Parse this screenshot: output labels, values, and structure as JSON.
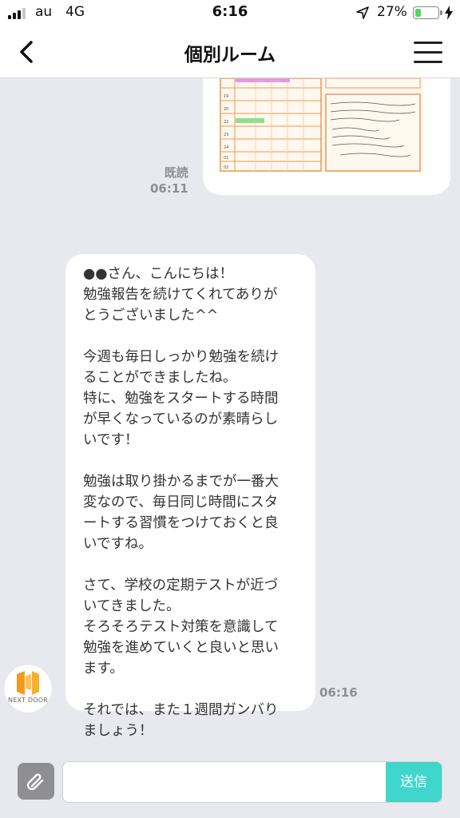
{
  "status_bar": {
    "carrier": "au",
    "network": "4G",
    "time": "6:16",
    "battery_percent": "27%",
    "battery_level": 0.27
  },
  "header": {
    "title": "個別ルーム"
  },
  "sent_message": {
    "read_label": "既読",
    "time": "06:11"
  },
  "received_message": {
    "lines": [
      "●●さん、こんにちは！",
      "勉強報告を続けてくれてありが",
      "とうございました^^",
      "",
      "今週も毎日しっかり勉強を続け",
      "ることができましたね。",
      "特に、勉強をスタートする時間",
      "が早くなっているのが素晴らし",
      "いです！",
      "",
      "勉強は取り掛かるまでが一番大",
      "変なので、毎日同じ時間にスタ",
      "ートする習慣をつけておくと良",
      "いですね。",
      "",
      "さて、学校の定期テストが近づ",
      "いてきました。",
      "そろそろテスト対策を意識して",
      "勉強を進めていくと良いと思い",
      "ます。",
      "",
      "それでは、また１週間ガンバり",
      "ましょう！"
    ],
    "time": "06:16",
    "sender_brand": "NEXT DOOR"
  },
  "composer": {
    "input_value": "",
    "send_label": "送信"
  },
  "colors": {
    "background": "#e8e8ef",
    "send_button": "#3fd6cc",
    "battery_fill": "#4cd964"
  },
  "icons": {
    "back": "chevron-left-icon",
    "menu": "hamburger-menu-icon",
    "attach": "paperclip-icon",
    "location": "location-arrow-icon",
    "charging": "lightning-bolt-icon"
  }
}
